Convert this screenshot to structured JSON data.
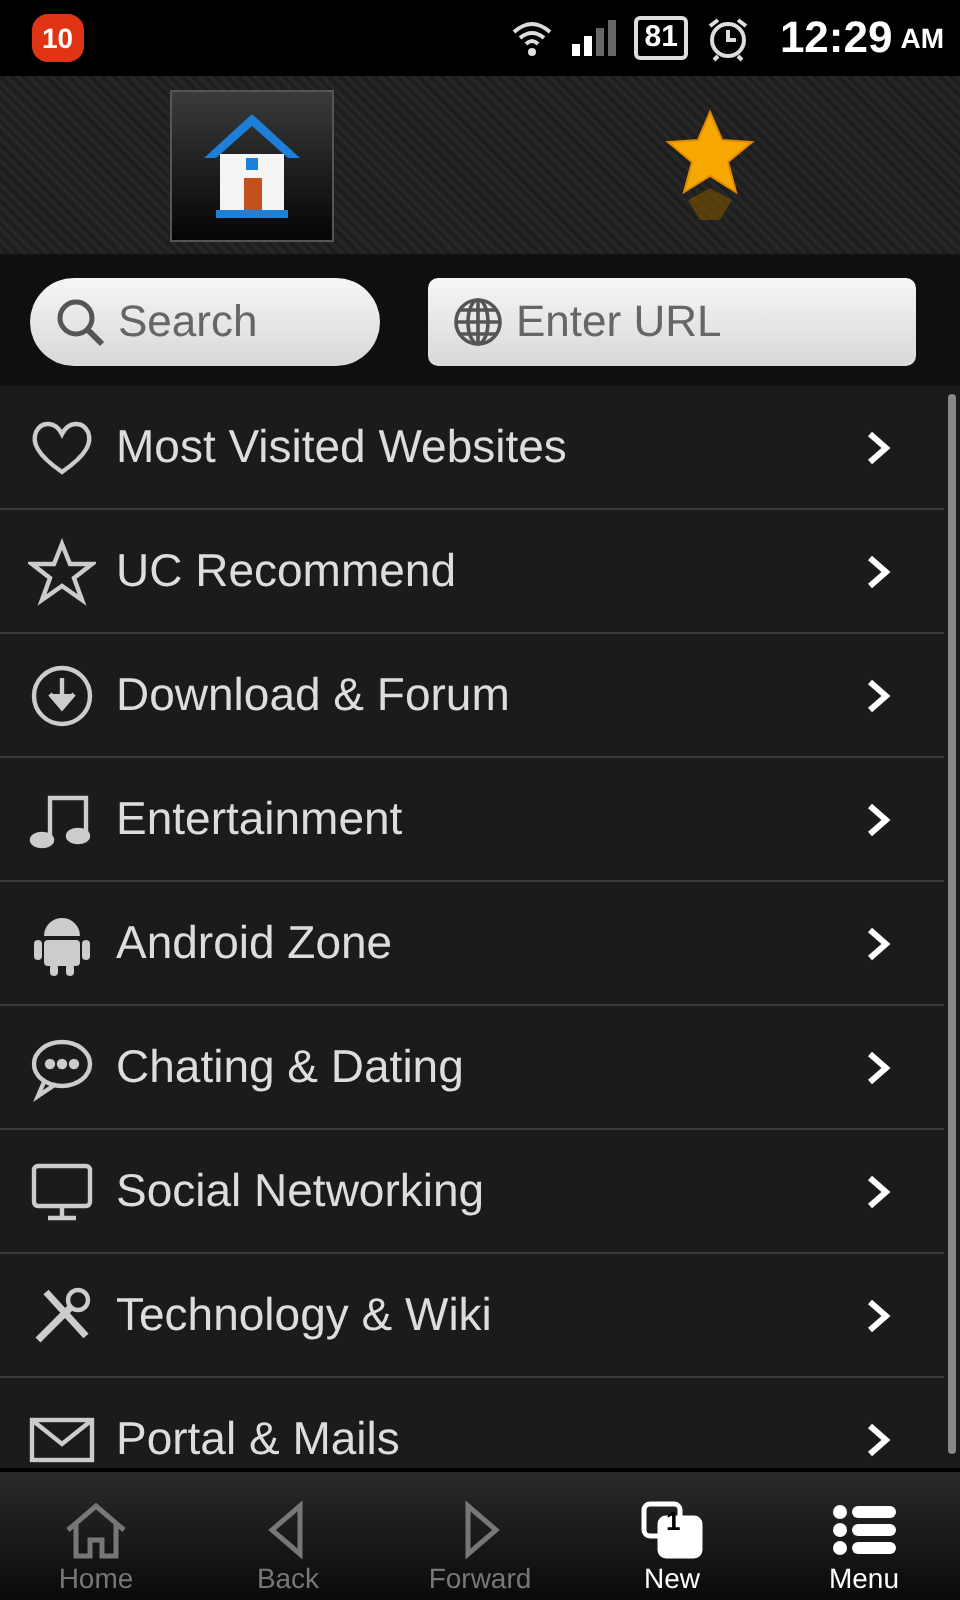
{
  "status_bar": {
    "notification_count": "10",
    "battery": "81",
    "time": "12:29",
    "meridiem": "AM"
  },
  "toolbar": [
    {
      "kind": "home",
      "selected": true
    },
    {
      "kind": "bookmark",
      "selected": false
    }
  ],
  "search": {
    "placeholder": "Search"
  },
  "url": {
    "placeholder": "Enter URL"
  },
  "categories": [
    {
      "kind": "heart",
      "label": "Most Visited Websites"
    },
    {
      "kind": "star",
      "label": "UC Recommend"
    },
    {
      "kind": "download",
      "label": "Download & Forum"
    },
    {
      "kind": "music",
      "label": "Entertainment"
    },
    {
      "kind": "android",
      "label": "Android Zone"
    },
    {
      "kind": "chat",
      "label": "Chating & Dating"
    },
    {
      "kind": "monitor",
      "label": "Social Networking"
    },
    {
      "kind": "tools",
      "label": "Technology & Wiki"
    },
    {
      "kind": "mail",
      "label": "Portal & Mails"
    }
  ],
  "bottom_bar": [
    {
      "kind": "home",
      "label": "Home",
      "disabled": true
    },
    {
      "kind": "back",
      "label": "Back",
      "disabled": true
    },
    {
      "kind": "forward",
      "label": "Forward",
      "disabled": true
    },
    {
      "kind": "tabs",
      "label": "New",
      "disabled": false,
      "count": "1"
    },
    {
      "kind": "menu",
      "label": "Menu",
      "disabled": false
    }
  ]
}
